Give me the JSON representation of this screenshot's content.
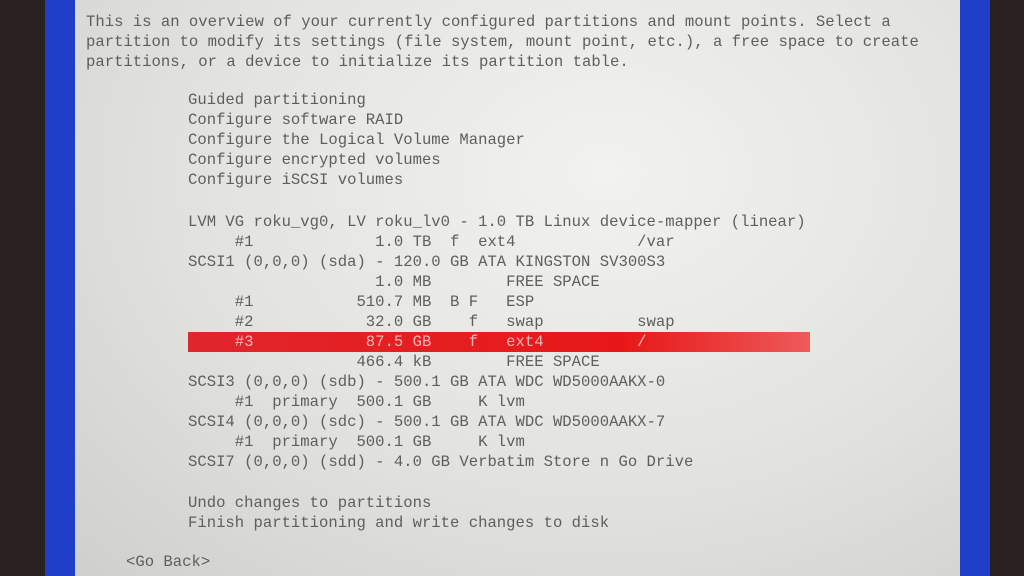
{
  "intro": [
    "This is an overview of your currently configured partitions and mount points. Select a",
    "partition to modify its settings (file system, mount point, etc.), a free space to create",
    "partitions, or a device to initialize its partition table."
  ],
  "menu": [
    "Guided partitioning",
    "Configure software RAID",
    "Configure the Logical Volume Manager",
    "Configure encrypted volumes",
    "Configure iSCSI volumes"
  ],
  "partitions": [
    "LVM VG roku_vg0, LV roku_lv0 - 1.0 TB Linux device-mapper (linear)",
    "     #1             1.0 TB  f  ext4             /var",
    "SCSI1 (0,0,0) (sda) - 120.0 GB ATA KINGSTON SV300S3",
    "                    1.0 MB        FREE SPACE",
    "     #1           510.7 MB  B F   ESP",
    "     #2            32.0 GB    f   swap          swap",
    "     #3            87.5 GB    f   ext4          /",
    "                  466.4 kB        FREE SPACE",
    "SCSI3 (0,0,0) (sdb) - 500.1 GB ATA WDC WD5000AAKX-0",
    "     #1  primary  500.1 GB     K lvm",
    "SCSI4 (0,0,0) (sdc) - 500.1 GB ATA WDC WD5000AAKX-7",
    "     #1  primary  500.1 GB     K lvm",
    "SCSI7 (0,0,0) (sdd) - 4.0 GB Verbatim Store n Go Drive"
  ],
  "actions": [
    "Undo changes to partitions",
    "Finish partitioning and write changes to disk"
  ],
  "go_back": "<Go Back>",
  "colors": {
    "selection": "#e8262a",
    "frame": "#1f3fc8",
    "panel": "#e4e4e0"
  }
}
